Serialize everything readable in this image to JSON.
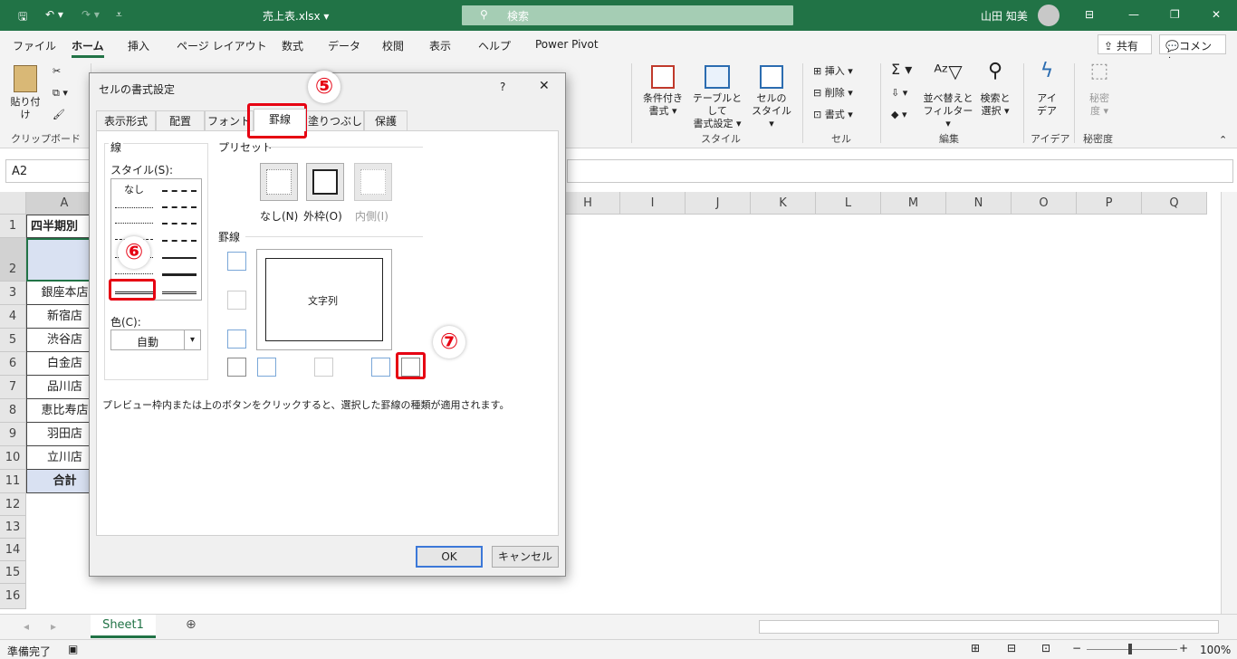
{
  "window": {
    "title": "売上表.xlsx ▾",
    "search": "検索",
    "user": "山田 知美"
  },
  "menu": {
    "items": [
      "ファイル",
      "ホーム",
      "挿入",
      "ページ レイアウト",
      "数式",
      "データ",
      "校閲",
      "表示",
      "ヘルプ",
      "Power Pivot"
    ],
    "share": "共有",
    "comment": "コメント"
  },
  "ribbon": {
    "paste": "貼り付け",
    "clipboard": "クリップボード",
    "cond_format": "条件付き\n書式 ▾",
    "table_format": "テーブルとして\n書式設定 ▾",
    "cell_style": "セルの\nスタイル ▾",
    "style_group": "スタイル",
    "insert": "挿入",
    "delete": "削除",
    "format": "書式",
    "cells_group": "セル",
    "sort": "並べ替えと\nフィルター ▾",
    "find": "検索と\n選択 ▾",
    "edit_group": "編集",
    "ideas": "アイ\nデア",
    "ideas_group": "アイデア",
    "sensitivity": "秘密\n度 ▾",
    "sensitivity_group": "秘密度"
  },
  "namebox": "A2",
  "columns": [
    "A",
    "H",
    "I",
    "J",
    "K",
    "L",
    "M",
    "N",
    "O",
    "P",
    "Q"
  ],
  "rows": [
    "1",
    "2",
    "3",
    "4",
    "5",
    "6",
    "7",
    "8",
    "9",
    "10",
    "11",
    "12",
    "13",
    "14",
    "15",
    "16"
  ],
  "cells": [
    "四半期別",
    "",
    "銀座本店",
    "新宿店",
    "渋谷店",
    "白金店",
    "品川店",
    "恵比寿店",
    "羽田店",
    "立川店",
    "合計"
  ],
  "sheet_tab": "Sheet1",
  "status": {
    "ready": "準備完了",
    "zoom": "100%"
  },
  "dialog": {
    "title": "セルの書式設定",
    "help": "?",
    "close": "✕",
    "tabs": [
      "表示形式",
      "配置",
      "フォント",
      "罫線",
      "塗りつぶし",
      "保護"
    ],
    "line_group": "線",
    "style_label": "スタイル(S):",
    "none": "なし",
    "color_label": "色(C):",
    "color_value": "自動",
    "preset_group": "プリセット",
    "preset_none": "なし(N)",
    "preset_outline": "外枠(O)",
    "preset_inside": "内側(I)",
    "border_group": "罫線",
    "preview_text": "文字列",
    "hint": "プレビュー枠内または上のボタンをクリックすると、選択した罫線の種類が適用されます。",
    "ok": "OK",
    "cancel": "キャンセル"
  },
  "badges": [
    "⑤",
    "⑥",
    "⑦"
  ]
}
